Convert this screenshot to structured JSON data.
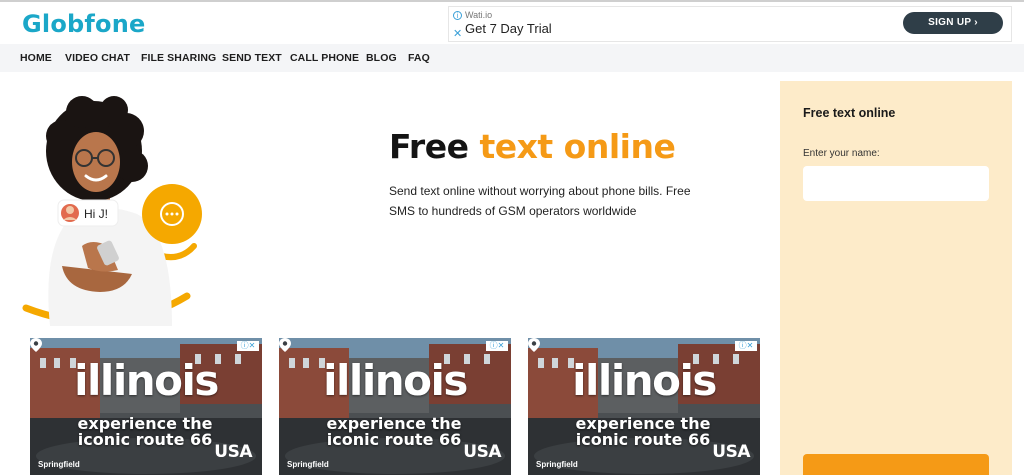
{
  "header": {
    "logo": "Globfone",
    "ad": {
      "sponsor": "Wati.io",
      "title": "Get 7 Day Trial",
      "button": "SIGN UP ›"
    }
  },
  "nav": {
    "items": [
      "HOME",
      "VIDEO CHAT",
      "FILE SHARING",
      "SEND TEXT",
      "CALL PHONE",
      "BLOG",
      "FAQ"
    ]
  },
  "hero": {
    "title_part1": "Free ",
    "title_part2": "text online",
    "description": "Send text online without worrying about phone bills. Free SMS to hundreds of GSM operators worldwide",
    "bubble": "Hi J!",
    "colors": {
      "accent": "#f59a16",
      "brand": "#1ba7c8"
    }
  },
  "sidebar": {
    "title": "Free text online",
    "name_label": "Enter your name:",
    "name_value": ""
  },
  "ads": [
    {
      "headline": "illinois",
      "sub": "experience the iconic route 66",
      "city": "Springfield",
      "brand": "USA"
    },
    {
      "headline": "illinois",
      "sub": "experience the iconic route 66",
      "city": "Springfield",
      "brand": "USA"
    },
    {
      "headline": "illinois",
      "sub": "experience the iconic route 66",
      "city": "Springfield",
      "brand": "USA"
    }
  ]
}
